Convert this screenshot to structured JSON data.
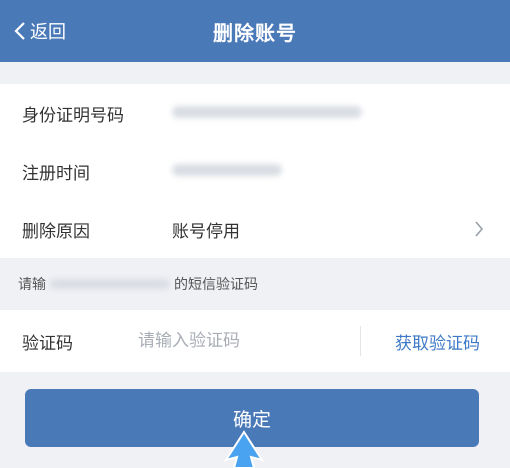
{
  "nav": {
    "back_label": "返回",
    "title": "删除账号"
  },
  "fields": [
    {
      "label": "身份证明号码",
      "value": ""
    },
    {
      "label": "注册时间",
      "value": ""
    },
    {
      "label": "删除原因",
      "value": "账号停用"
    }
  ],
  "hint": {
    "prefix": "请输",
    "suffix": "的短信验证码"
  },
  "verify": {
    "label": "验证码",
    "placeholder": "请输入验证码",
    "get_code_label": "获取验证码"
  },
  "confirm_label": "确定",
  "colors": {
    "primary": "#4a79b8",
    "link": "#3d79c6",
    "background": "#f0f1f5"
  }
}
